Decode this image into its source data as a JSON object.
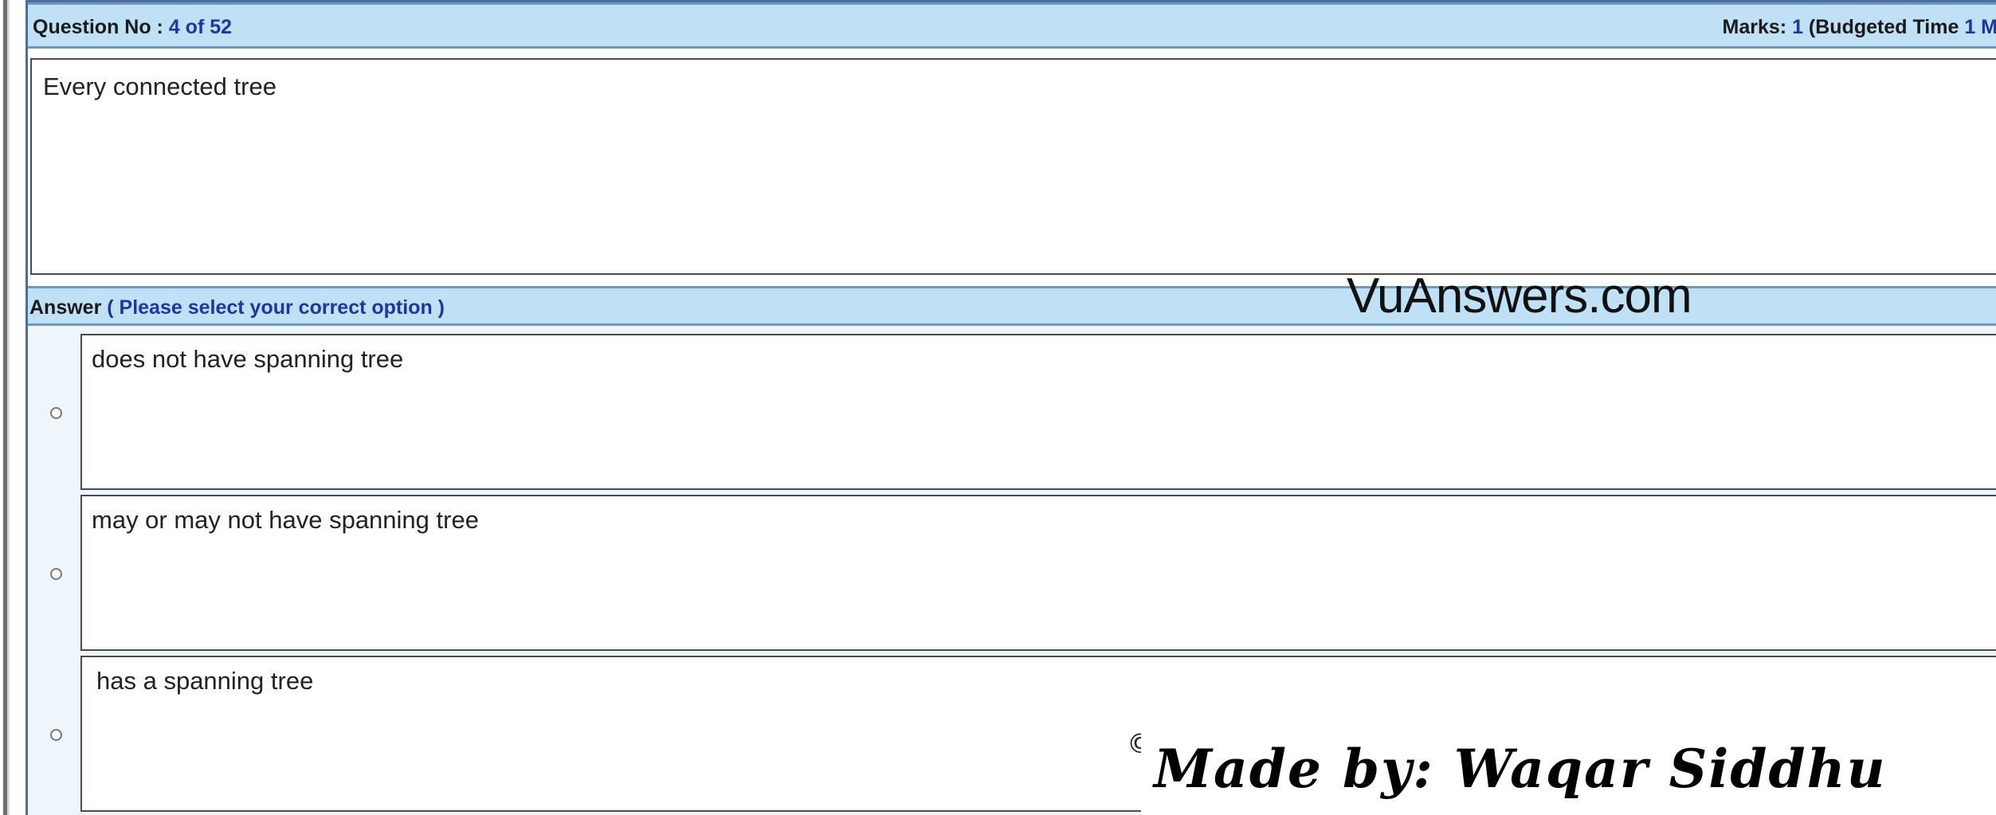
{
  "question_bar": {
    "label": "Question No : ",
    "current": "4",
    "of_text": " of ",
    "total": "52",
    "marks_label": "Marks: ",
    "marks_value": "1",
    "budget_label": " (Budgeted Time ",
    "budget_value": "1 M"
  },
  "question": {
    "text": "Every connected tree"
  },
  "answer_bar": {
    "label": "Answer",
    "hint": " ( Please select your correct option )"
  },
  "watermarks": {
    "site": "VuAnswers.com",
    "author": "Made by: Waqar Siddhu",
    "copyright_symbol": "©"
  },
  "options": [
    {
      "text": "does not have spanning tree"
    },
    {
      "text": "may or may not have spanning tree"
    },
    {
      "text": " has a spanning tree"
    }
  ],
  "colors": {
    "bar_background": "#bfe0f5",
    "bar_border": "#6f97bf",
    "accent_text": "#1f35a0",
    "answers_background": "#eef6fc"
  }
}
